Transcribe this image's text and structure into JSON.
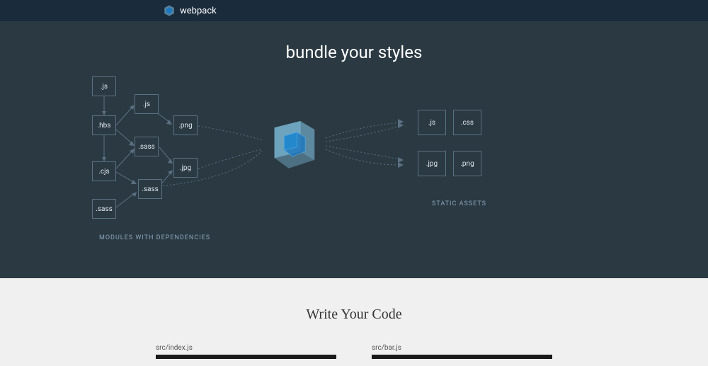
{
  "header": {
    "brand": "webpack"
  },
  "hero": {
    "title": "bundle your styles",
    "modules_label": "MODULES WITH DEPENDENCIES",
    "static_label": "STATIC ASSETS",
    "input_nodes": {
      "n1": ".js",
      "n2": ".js",
      "n3": ".hbs",
      "n4": ".png",
      "n5": ".cjs",
      "n6": ".sass",
      "n7": ".jpg",
      "n8": ".sass",
      "n9": ".sass"
    },
    "output_nodes": {
      "o1": ".js",
      "o2": ".css",
      "o3": ".jpg",
      "o4": ".png"
    }
  },
  "code": {
    "title": "Write Your Code",
    "file1": "src/index.js",
    "file2": "src/bar.js"
  }
}
